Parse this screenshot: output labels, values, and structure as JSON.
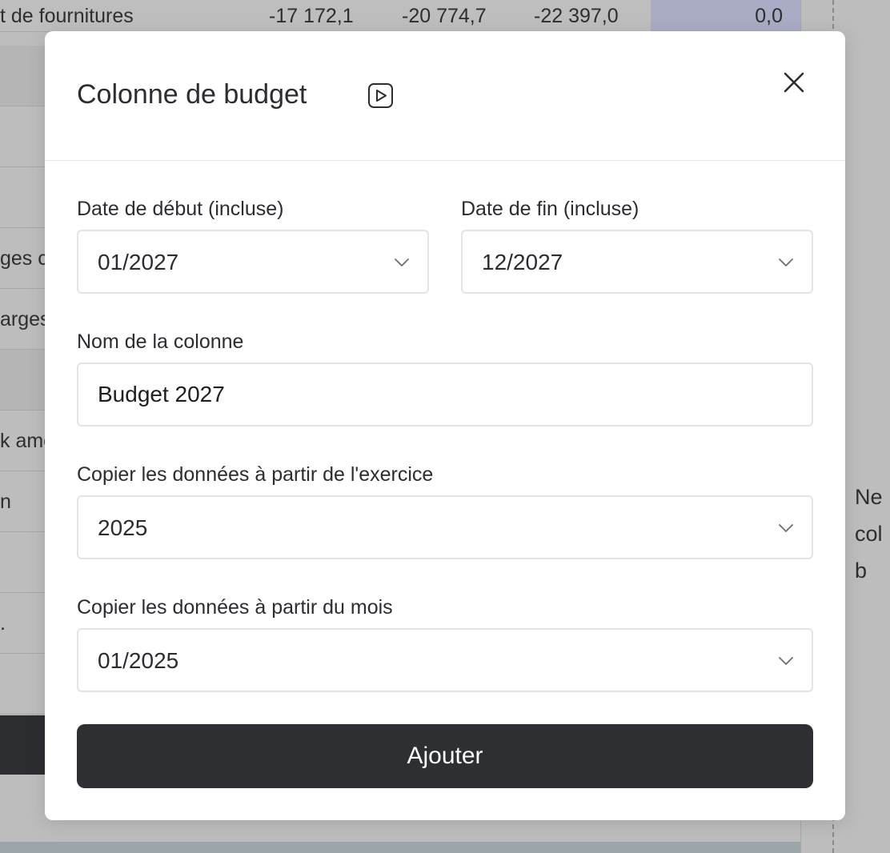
{
  "background": {
    "top_row": {
      "label": "t de fournitures",
      "values": [
        "-17 172,1",
        "-20 774,7",
        "-22 397,0"
      ],
      "highlight_value": "0,0"
    },
    "side_rows": [
      "",
      "",
      "",
      "ges c",
      "arges",
      "",
      "k amo",
      "n",
      "",
      ".",
      ""
    ],
    "right_panel_text": "Ne\ncol\nb"
  },
  "modal": {
    "title": "Colonne de budget",
    "start_date": {
      "label": "Date de début (incluse)",
      "value": "01/2027"
    },
    "end_date": {
      "label": "Date de fin (incluse)",
      "value": "12/2027"
    },
    "column_name": {
      "label": "Nom de la colonne",
      "value": "Budget 2027"
    },
    "copy_fiscal_year": {
      "label": "Copier les données à partir de l'exercice",
      "value": "2025"
    },
    "copy_month": {
      "label": "Copier les données à partir du mois",
      "value": "01/2025"
    },
    "submit_label": "Ajouter"
  },
  "icons": {
    "video": "play-video-icon",
    "close": "close-icon",
    "dropdown": "chevron-down-icon"
  },
  "colors": {
    "primary_button": "#2e2f33",
    "border": "#e3e4e7",
    "overlay": "#b8b8b8",
    "highlight_column": "#a9acc4"
  }
}
